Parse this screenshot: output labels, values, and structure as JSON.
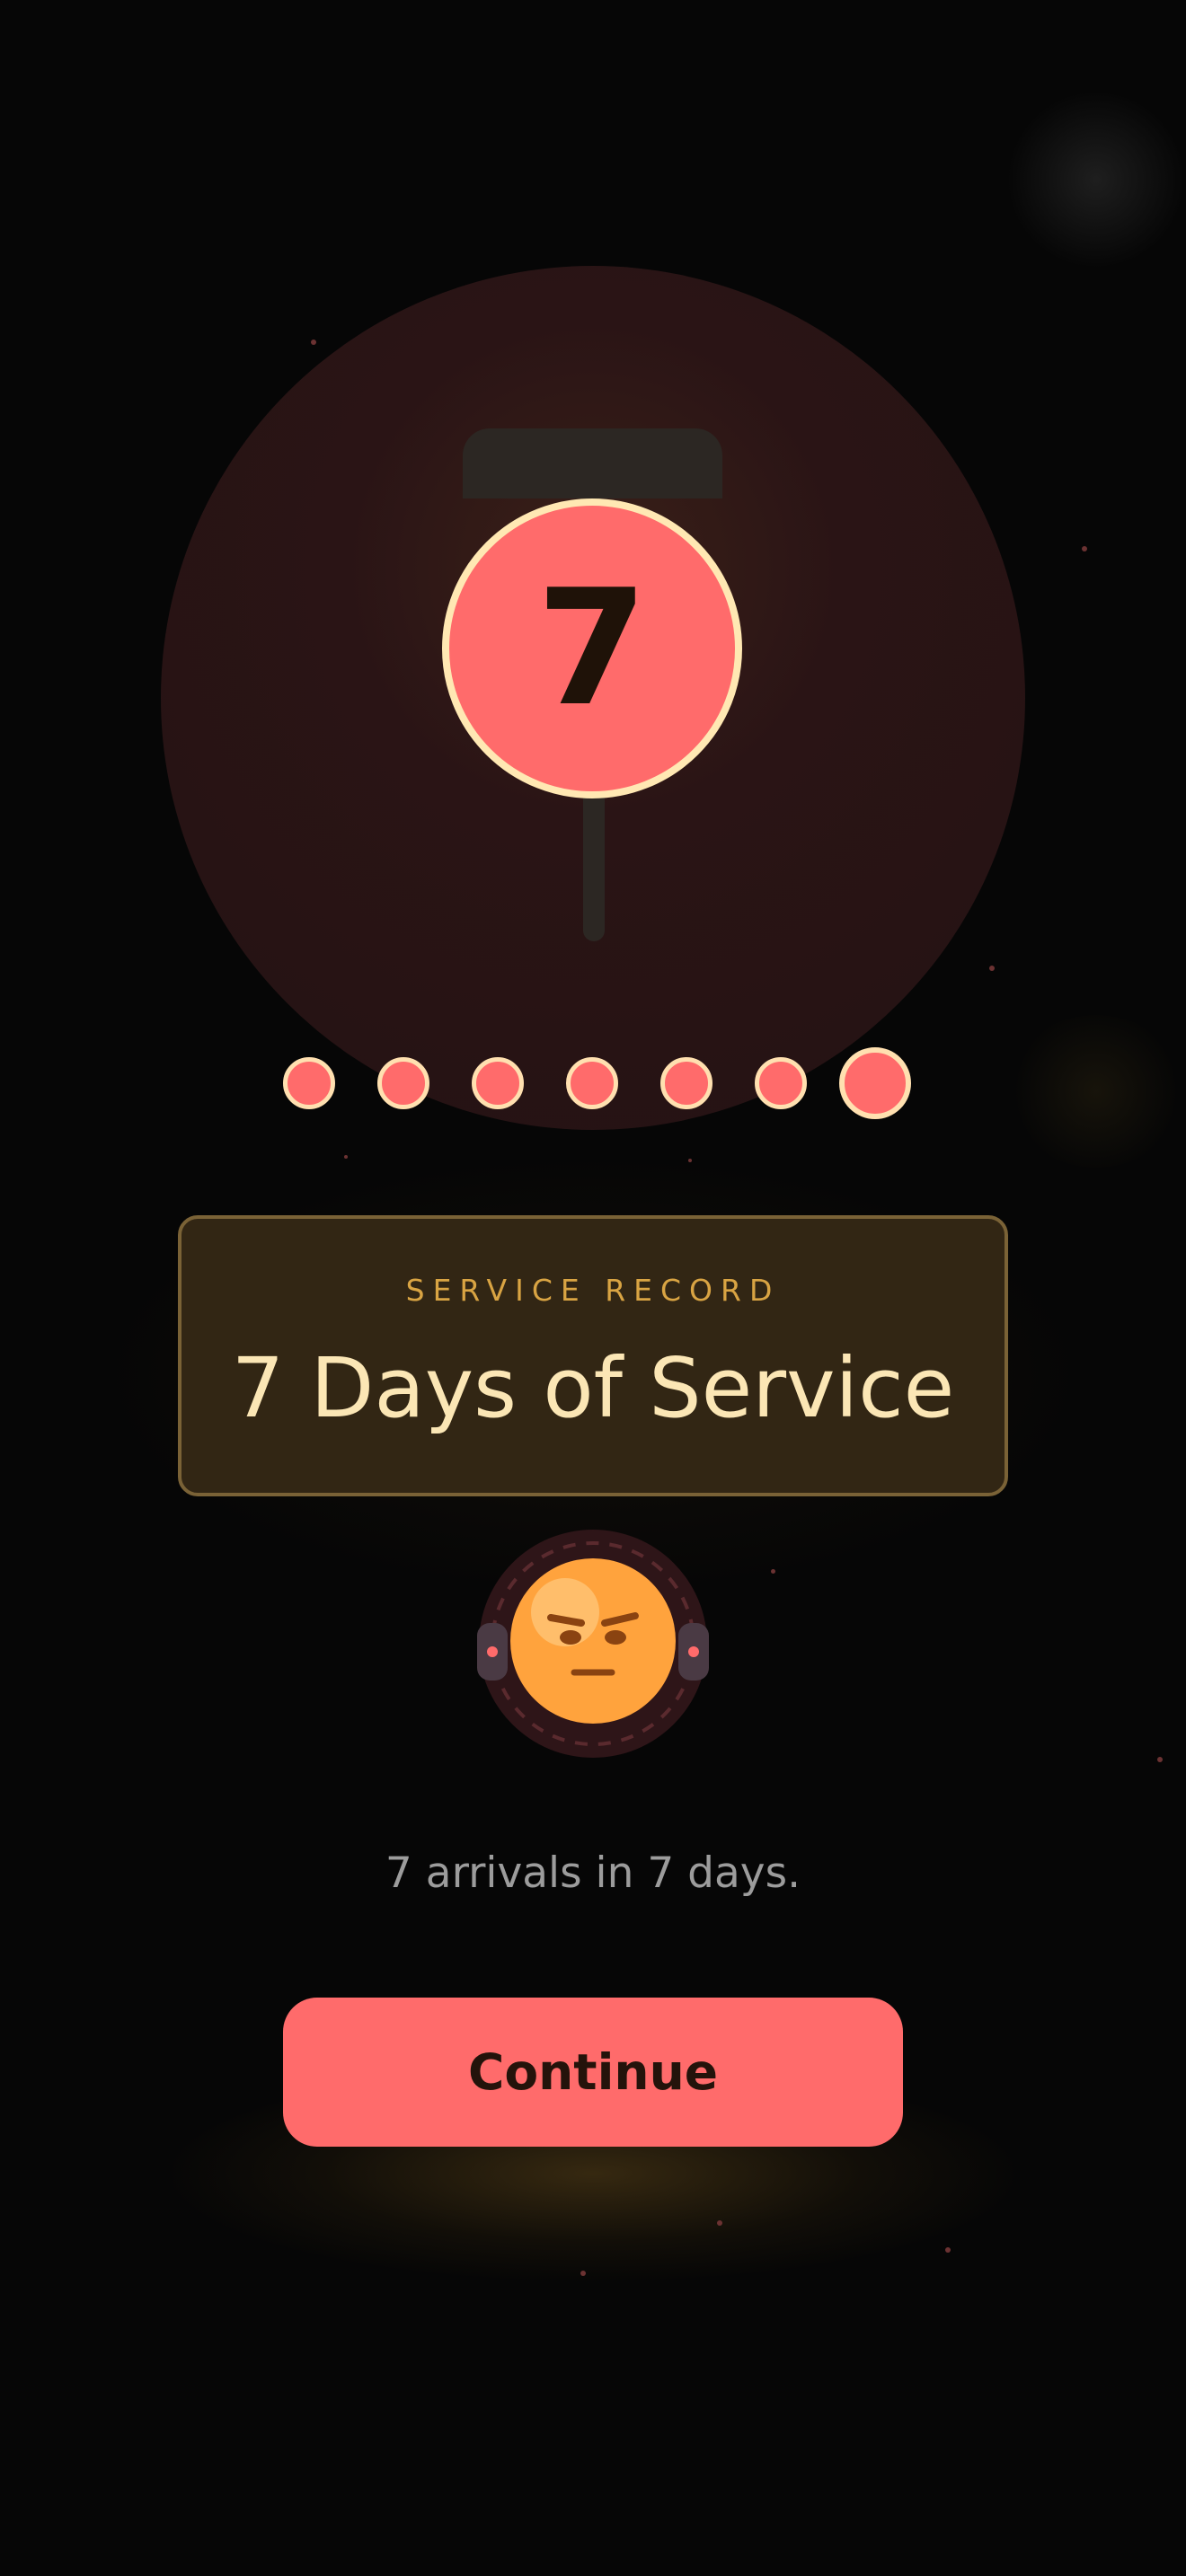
{
  "badge": {
    "number": "7",
    "icon": "number-badge-pin-icon"
  },
  "progress": {
    "total_dots": 7,
    "filled_dots": 7,
    "current_index": 6
  },
  "record": {
    "label": "SERVICE RECORD",
    "title": "7 Days of Service"
  },
  "avatar": {
    "icon": "grumpy-face-avatar-icon"
  },
  "caption": "7 arrivals in 7 days.",
  "actions": {
    "continue_label": "Continue"
  },
  "colors": {
    "background": "#060606",
    "accent": "#ff6b6b",
    "cream": "#ffe8b3",
    "gold": "#d9a443",
    "card": "#322614",
    "avatar_face": "#ffa33d"
  }
}
